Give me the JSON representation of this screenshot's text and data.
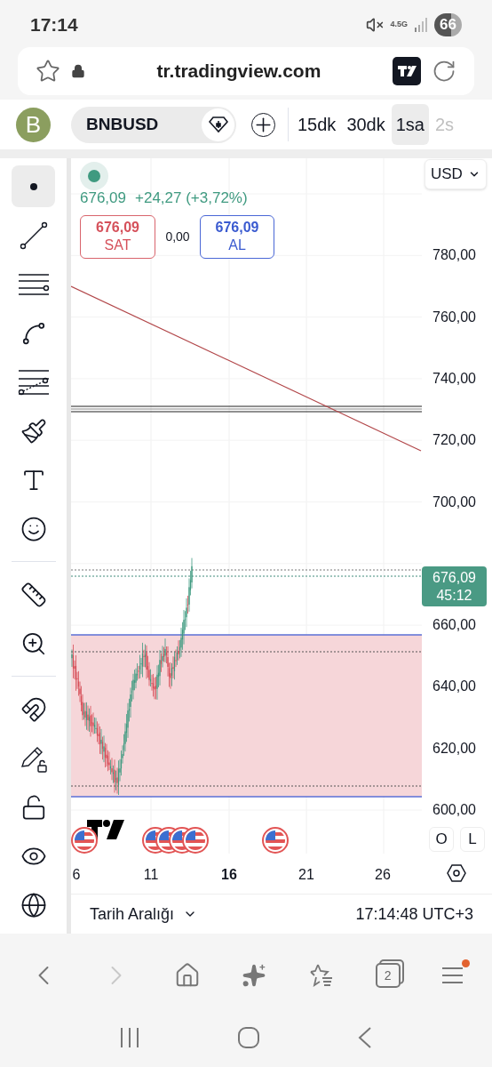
{
  "status_bar": {
    "time": "17:14",
    "network": "4.5G",
    "battery": "66"
  },
  "address_bar": {
    "url": "tr.tradingview.com"
  },
  "toolbar": {
    "avatar": "B",
    "symbol": "BNBUSD",
    "intervals": [
      {
        "label": "15dk",
        "selected": false,
        "dimmed": false
      },
      {
        "label": "30dk",
        "selected": false,
        "dimmed": false
      },
      {
        "label": "1sa",
        "selected": true,
        "dimmed": false
      },
      {
        "label": "2s",
        "selected": false,
        "dimmed": true
      }
    ]
  },
  "drawing_tools": [
    {
      "selected": true
    },
    {
      "selected": false
    },
    {
      "selected": false
    },
    {
      "selected": false
    },
    {
      "selected": false
    },
    {
      "selected": false
    },
    {
      "selected": false
    },
    {
      "selected": false
    },
    {
      "selected": false
    },
    {
      "selected": false
    },
    {
      "selected": false
    },
    {
      "selected": false
    },
    {
      "selected": false
    },
    {
      "selected": false
    },
    {
      "selected": false
    }
  ],
  "legend": {
    "price": "676,09",
    "change": "+24,27 (+3,72%)",
    "sell": {
      "price": "676,09",
      "label": "SAT"
    },
    "spread": "0,00",
    "buy": {
      "price": "676,09",
      "label": "AL"
    }
  },
  "currency": "USD",
  "price_axis": [
    "780,00",
    "760,00",
    "740,00",
    "720,00",
    "700,00",
    "660,00",
    "640,00",
    "620,00",
    "600,00"
  ],
  "last_price": {
    "price": "676,09",
    "countdown": "45:12"
  },
  "date_axis": [
    {
      "label": "6",
      "bold": false
    },
    {
      "label": "11",
      "bold": false
    },
    {
      "label": "16",
      "bold": true
    },
    {
      "label": "21",
      "bold": false
    },
    {
      "label": "26",
      "bold": false
    }
  ],
  "scale_buttons": [
    "O",
    "L"
  ],
  "bottom_bar": {
    "range": "Tarih Aralığı",
    "clock": "17:14:48 UTC+3"
  },
  "browser_nav": {
    "forward_disabled": true,
    "tabs": "2",
    "menu_notification": true
  }
}
